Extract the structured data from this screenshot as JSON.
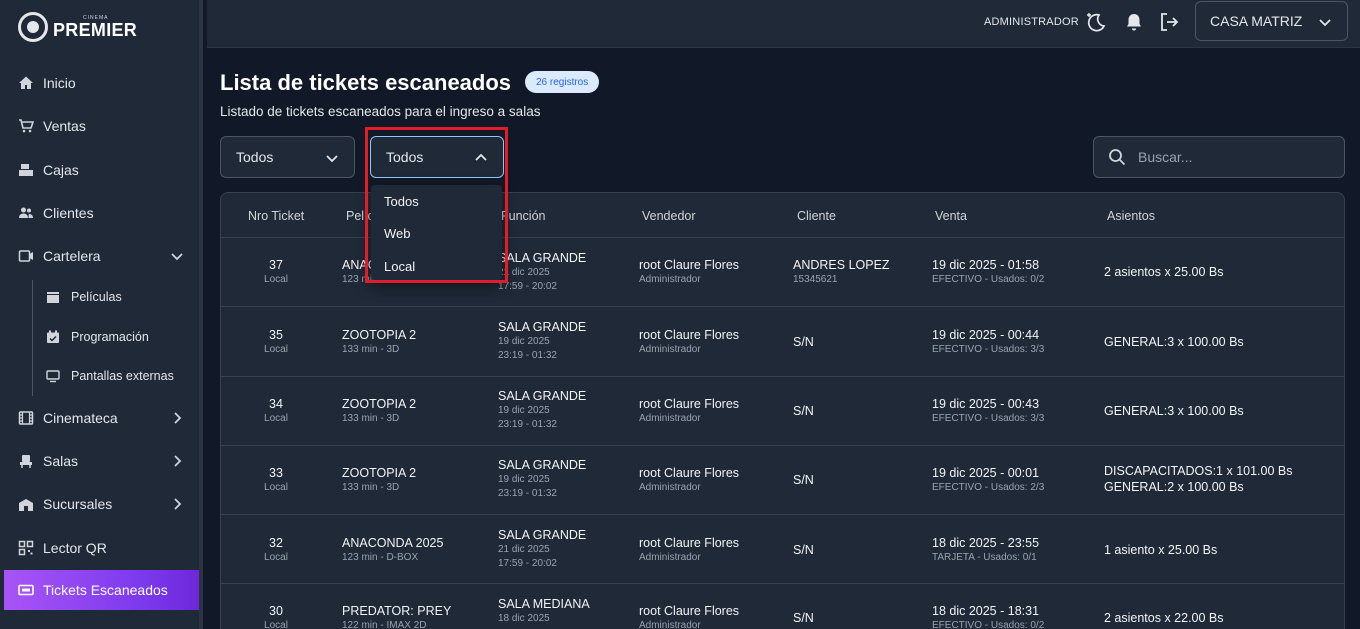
{
  "brand": {
    "small": "CINEMA",
    "name": "PREMIER"
  },
  "sidebar": {
    "items": [
      {
        "label": "Inicio",
        "icon": "home-icon"
      },
      {
        "label": "Ventas",
        "icon": "cart-icon"
      },
      {
        "label": "Cajas",
        "icon": "cash-register-icon"
      },
      {
        "label": "Clientes",
        "icon": "users-icon"
      },
      {
        "label": "Cartelera",
        "icon": "billboard-icon"
      },
      {
        "label": "Cinemateca",
        "icon": "film-icon"
      },
      {
        "label": "Salas",
        "icon": "seat-icon"
      },
      {
        "label": "Sucursales",
        "icon": "building-icon"
      },
      {
        "label": "Lector QR",
        "icon": "qr-icon"
      },
      {
        "label": "Tickets Escaneados",
        "icon": "ticket-icon"
      }
    ],
    "subitems": [
      {
        "label": "Películas",
        "icon": "clapper-icon"
      },
      {
        "label": "Programación",
        "icon": "calendar-icon"
      },
      {
        "label": "Pantallas externas",
        "icon": "monitor-icon"
      }
    ]
  },
  "topbar": {
    "role": "ADMINISTRADOR",
    "branch": "CASA MATRIZ"
  },
  "page": {
    "title": "Lista de tickets escaneados",
    "badge": "26 registros",
    "subtitle": "Listado de tickets escaneados para el ingreso a salas"
  },
  "filters": {
    "first": "Todos",
    "second": "Todos",
    "second_options": [
      "Todos",
      "Web",
      "Local"
    ],
    "search_placeholder": "Buscar..."
  },
  "table": {
    "headers": [
      "Nro Ticket",
      "Película",
      "Función",
      "Vendedor",
      "Cliente",
      "Venta",
      "Asientos"
    ],
    "rows": [
      {
        "nro": "37",
        "canal": "Local",
        "pelicula": "ANACONDA 2025",
        "detalle": "123 min - D-BOX",
        "sala": "SALA GRANDE",
        "fecha": "21 dic 2025",
        "horario": "17:59 - 20:02",
        "vendedor": "root Claure Flores",
        "rol": "Administrador",
        "cliente": "ANDRES LOPEZ",
        "ci": "15345621",
        "venta": "19 dic 2025 - 01:58",
        "pago": "EFECTIVO - Usados: 0/2",
        "asientos": [
          "2 asientos x 25.00 Bs"
        ]
      },
      {
        "nro": "35",
        "canal": "Local",
        "pelicula": "ZOOTOPIA 2",
        "detalle": "133 min - 3D",
        "sala": "SALA GRANDE",
        "fecha": "19 dic 2025",
        "horario": "23:19 - 01:32",
        "vendedor": "root Claure Flores",
        "rol": "Administrador",
        "cliente": "S/N",
        "ci": "",
        "venta": "19 dic 2025 - 00:44",
        "pago": "EFECTIVO - Usados: 3/3",
        "asientos": [
          "GENERAL:3 x 100.00 Bs"
        ]
      },
      {
        "nro": "34",
        "canal": "Local",
        "pelicula": "ZOOTOPIA 2",
        "detalle": "133 min - 3D",
        "sala": "SALA GRANDE",
        "fecha": "19 dic 2025",
        "horario": "23:19 - 01:32",
        "vendedor": "root Claure Flores",
        "rol": "Administrador",
        "cliente": "S/N",
        "ci": "",
        "venta": "19 dic 2025 - 00:43",
        "pago": "EFECTIVO - Usados: 3/3",
        "asientos": [
          "GENERAL:3 x 100.00 Bs"
        ]
      },
      {
        "nro": "33",
        "canal": "Local",
        "pelicula": "ZOOTOPIA 2",
        "detalle": "133 min - 3D",
        "sala": "SALA GRANDE",
        "fecha": "19 dic 2025",
        "horario": "23:19 - 01:32",
        "vendedor": "root Claure Flores",
        "rol": "Administrador",
        "cliente": "S/N",
        "ci": "",
        "venta": "19 dic 2025 - 00:01",
        "pago": "EFECTIVO - Usados: 2/3",
        "asientos": [
          "DISCAPACITADOS:1 x 101.00 Bs",
          "GENERAL:2 x 100.00 Bs"
        ]
      },
      {
        "nro": "32",
        "canal": "Local",
        "pelicula": "ANACONDA 2025",
        "detalle": "123 min - D-BOX",
        "sala": "SALA GRANDE",
        "fecha": "21 dic 2025",
        "horario": "17:59 - 20:02",
        "vendedor": "root Claure Flores",
        "rol": "Administrador",
        "cliente": "S/N",
        "ci": "",
        "venta": "18 dic 2025 - 23:55",
        "pago": "TARJETA - Usados: 0/1",
        "asientos": [
          "1 asiento x 25.00 Bs"
        ]
      },
      {
        "nro": "30",
        "canal": "Local",
        "pelicula": "PREDATOR: PREY",
        "detalle": "122 min - IMAX 2D",
        "sala": "SALA MEDIANA",
        "fecha": "18 dic 2025",
        "horario": "",
        "vendedor": "root Claure Flores",
        "rol": "Administrador",
        "cliente": "S/N",
        "ci": "",
        "venta": "18 dic 2025 - 18:31",
        "pago": "EFECTIVO - Usados: 0/2",
        "asientos": [
          "2 asientos x 22.00 Bs"
        ]
      }
    ]
  },
  "colors": {
    "accent": "#7c3aed",
    "highlight": "#e11d2a",
    "badge_text": "#2563eb"
  }
}
